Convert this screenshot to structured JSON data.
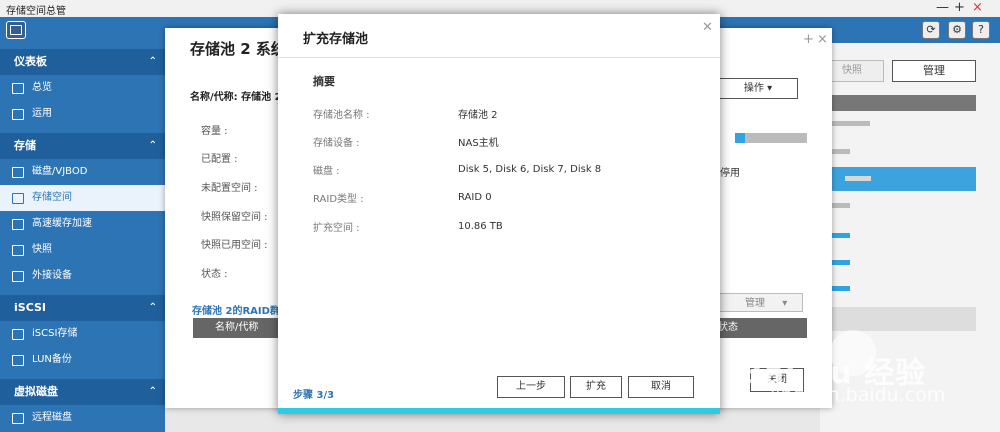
{
  "app": {
    "title": "存储空间总管"
  },
  "window_controls": {
    "minimize": "—",
    "maximize": "+",
    "close": "×"
  },
  "toolbar_icons": [
    "app-icon",
    "refresh-icon",
    "gear-icon",
    "help-icon"
  ],
  "sidebar": {
    "sections": [
      {
        "label": "仪表板",
        "items": [
          {
            "label": "总览"
          },
          {
            "label": "运用"
          }
        ]
      },
      {
        "label": "存储",
        "items": [
          {
            "label": "磁盘/VJBOD"
          },
          {
            "label": "存储空间",
            "active": true
          },
          {
            "label": "高速缓存加速"
          },
          {
            "label": "快照"
          },
          {
            "label": "外接设备"
          }
        ]
      },
      {
        "label": "iSCSI",
        "items": [
          {
            "label": "iSCSI存储"
          },
          {
            "label": "LUN备份"
          }
        ]
      },
      {
        "label": "虚拟磁盘",
        "items": [
          {
            "label": "远程磁盘"
          }
        ]
      }
    ]
  },
  "background_panel": {
    "snapshot_label": "快照",
    "manage_label": "管理"
  },
  "pool_window": {
    "title": "存储池 2 系统",
    "name_label": "名称/代称: 存储池 2",
    "fields": [
      "容量 :",
      "已配置 :",
      "未配置空间 :",
      "快照保留空间 :",
      "快照已用空间 :",
      "状态 :"
    ],
    "operate_label": "操作",
    "disable_label": "停用",
    "manage_label": "管理",
    "raid_group_label": "存储池 2的RAID群组",
    "col_name": "名称/代称",
    "col_status": "状态",
    "next_label": "关闭"
  },
  "modal": {
    "title": "扩充存储池",
    "summary_title": "摘要",
    "rows": [
      {
        "key": "存储池名称 :",
        "value": "存储池 2"
      },
      {
        "key": "存储设备 :",
        "value": "NAS主机"
      },
      {
        "key": "磁盘 :",
        "value": "Disk 5, Disk 6, Disk 7, Disk 8"
      },
      {
        "key": "RAID类型 :",
        "value": "RAID 0"
      },
      {
        "key": "扩充空间 :",
        "value": "10.86 TB"
      }
    ],
    "step": "步骤 3/3",
    "buttons": {
      "prev": "上一步",
      "expand": "扩充",
      "cancel": "取消"
    }
  },
  "watermark": {
    "brand": "Bai du 经验",
    "url": "jingyan.baidu.com"
  },
  "colors": {
    "accent": "#2d74b5",
    "footer_bar": "#2ecbe3"
  }
}
